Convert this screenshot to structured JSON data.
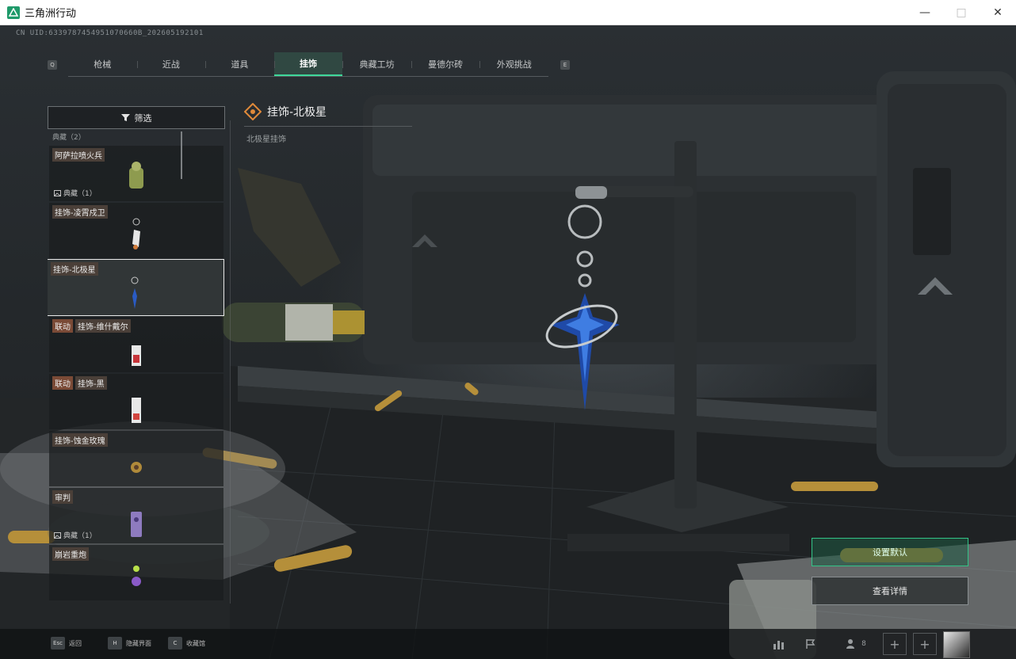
{
  "window": {
    "title": "三角洲行动"
  },
  "uid_text": "CN UID:6339787454951070660B_202605192101",
  "tabs": {
    "left_key": "Q",
    "right_key": "E",
    "items": [
      {
        "label": "枪械"
      },
      {
        "label": "近战"
      },
      {
        "label": "道具"
      },
      {
        "label": "挂饰",
        "active": true
      },
      {
        "label": "典藏工坊"
      },
      {
        "label": "曼德尔砖"
      },
      {
        "label": "外观挑战"
      }
    ]
  },
  "filter": {
    "label": "筛选"
  },
  "list": {
    "stub_text": "典藏（2）",
    "items": [
      {
        "tag": "阿萨拉喷火兵",
        "count": "典藏（1）"
      },
      {
        "tag": "挂饰-凌霄戍卫"
      },
      {
        "tag": "挂饰-北极星",
        "selected": true
      },
      {
        "tag": "联动",
        "name": "挂饰-维什戴尔"
      },
      {
        "tag": "联动",
        "name": "挂饰-黑"
      },
      {
        "tag": "挂饰-蚀金玫瑰"
      },
      {
        "tag": "审判",
        "count": "典藏（1）"
      },
      {
        "tag": "崩岩重炮"
      }
    ]
  },
  "detail": {
    "title": "挂饰-北极星",
    "subtitle": "北极星挂饰"
  },
  "actions": {
    "set_default": "设置默认",
    "view_details": "查看详情"
  },
  "bottom": {
    "hints": [
      {
        "key": "Esc",
        "label": "返回"
      },
      {
        "key": "H",
        "label": "隐藏界面"
      },
      {
        "key": "C",
        "label": "收藏馆"
      }
    ],
    "friends_count": "8"
  },
  "colors": {
    "accent_green": "#3ed79a",
    "tag_link": "#7a4a36",
    "tag_normal": "#4a3f38"
  }
}
